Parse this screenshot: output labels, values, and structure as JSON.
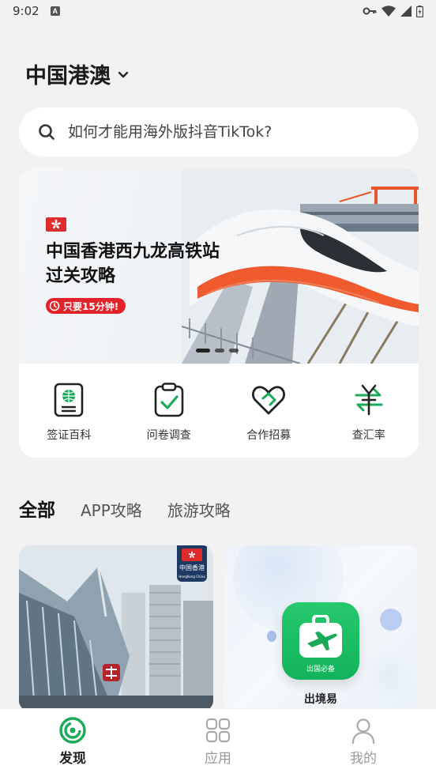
{
  "status_bar": {
    "time": "9:02",
    "notification_icon_letter": "A",
    "icons": [
      "vpn-key-icon",
      "wifi-icon",
      "signal-icon",
      "battery-icon"
    ]
  },
  "header": {
    "region": "中国港澳",
    "region_dropdown_icon": "chevron-down-icon"
  },
  "search": {
    "placeholder": "如何才能用海外版抖音TikTok?"
  },
  "banner": {
    "title_line1": "中国香港西九龙高铁站",
    "title_line2": "过关攻略",
    "pill_text": "只要15分钟!",
    "slides": 3,
    "active_slide": 1
  },
  "quick_tools": [
    {
      "label": "签证百科",
      "icon": "passport-icon"
    },
    {
      "label": "问卷调查",
      "icon": "clipboard-check-icon"
    },
    {
      "label": "合作招募",
      "icon": "handshake-heart-icon"
    },
    {
      "label": "查汇率",
      "icon": "exchange-rate-icon"
    }
  ],
  "tabs": [
    {
      "label": "全部",
      "active": true
    },
    {
      "label": "APP攻略",
      "active": false
    },
    {
      "label": "旅游攻略",
      "active": false
    }
  ],
  "cards": {
    "left_badge_text": "中国香港",
    "left_badge_subtext": "HongKong China",
    "right_app_tag": "出国必备",
    "right_app_name": "出境易"
  },
  "bottom_nav": [
    {
      "label": "发现",
      "icon": "discover-icon",
      "active": true
    },
    {
      "label": "应用",
      "icon": "apps-icon",
      "active": false
    },
    {
      "label": "我的",
      "icon": "profile-icon",
      "active": false
    }
  ],
  "colors": {
    "accent_green": "#1aaa5a",
    "banner_red": "#e3232a",
    "background": "#f2f2f2"
  }
}
